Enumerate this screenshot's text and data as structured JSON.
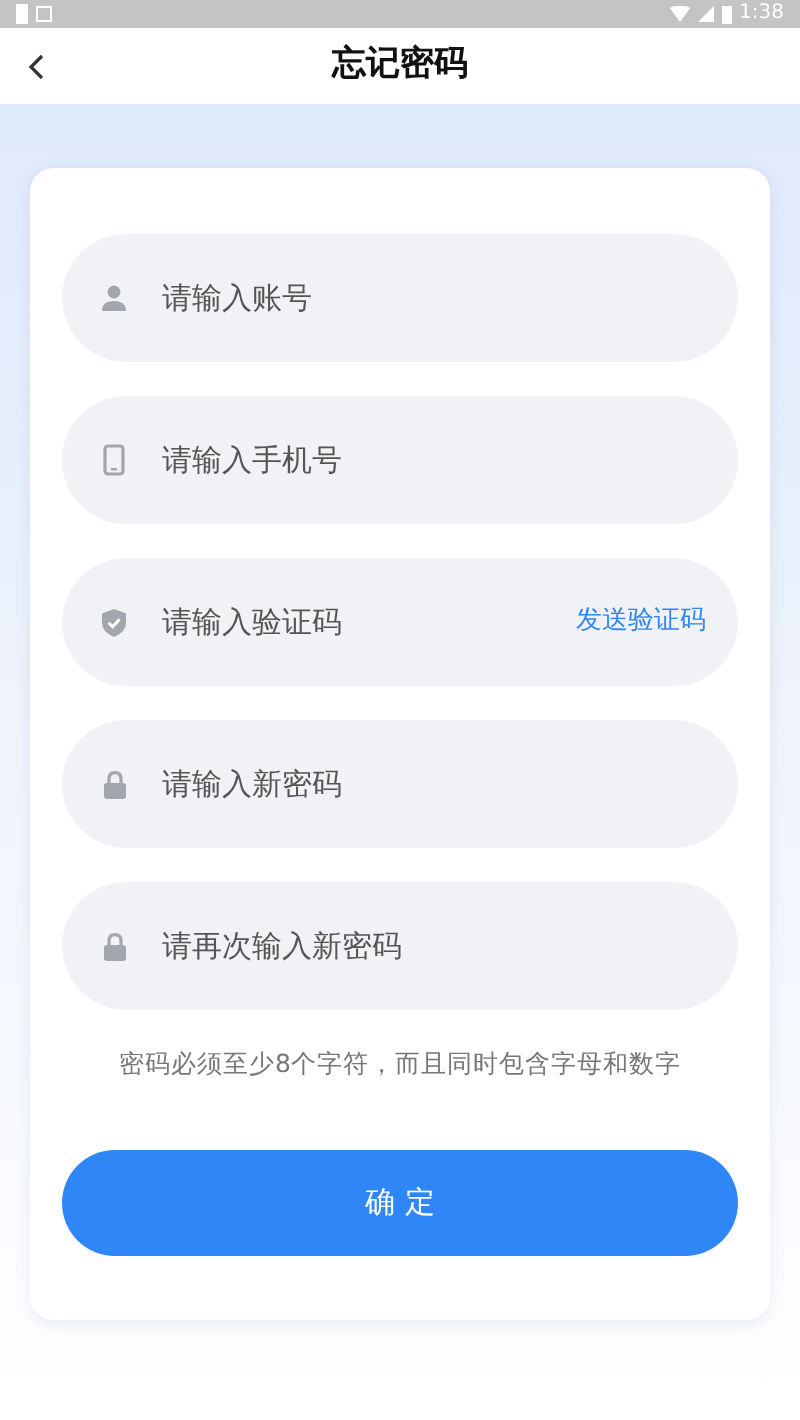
{
  "status_bar": {
    "time": "1:38"
  },
  "header": {
    "title": "忘记密码"
  },
  "fields": [
    {
      "kind": "user",
      "placeholder": "请输入账号"
    },
    {
      "kind": "phone",
      "placeholder": "请输入手机号"
    },
    {
      "kind": "shield",
      "placeholder": "请输入验证码",
      "action": "发送验证码"
    },
    {
      "kind": "lock",
      "placeholder": "请输入新密码"
    },
    {
      "kind": "lock",
      "placeholder": "请再次输入新密码"
    }
  ],
  "hint": "密码必须至少8个字符，而且同时包含字母和数字",
  "submit": "确 定"
}
